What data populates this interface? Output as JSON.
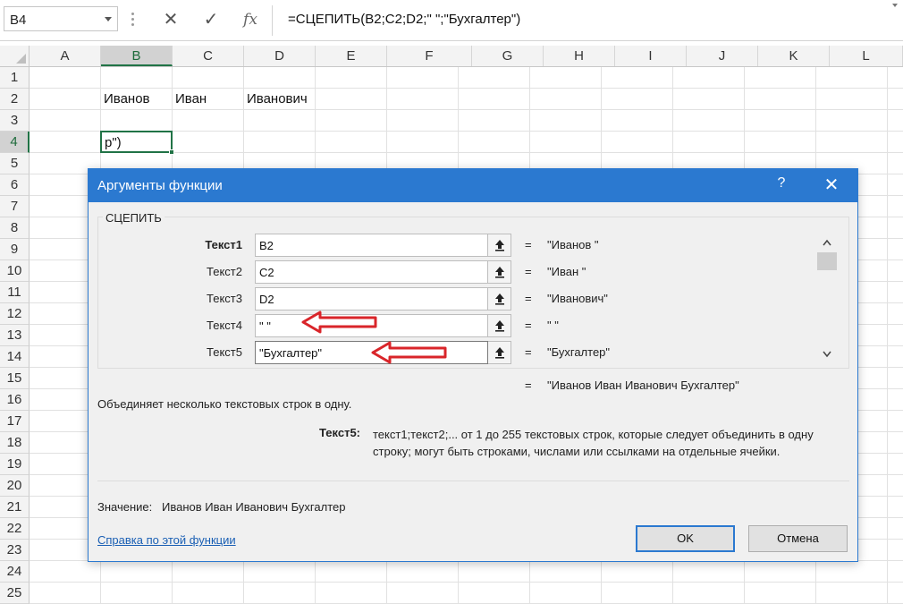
{
  "formula_bar": {
    "name_box": "B4",
    "formula": "=СЦЕПИТЬ(B2;C2;D2;\" \";\"Бухгалтер\")",
    "cancel_icon": "✕",
    "enter_icon": "✓",
    "fx_label": "fx"
  },
  "sheet": {
    "columns": [
      "A",
      "B",
      "C",
      "D",
      "E",
      "F",
      "G",
      "H",
      "I",
      "J",
      "K",
      "L"
    ],
    "rows": [
      "1",
      "2",
      "3",
      "4",
      "5",
      "6",
      "7",
      "8",
      "9",
      "10",
      "11",
      "12",
      "13",
      "14",
      "15",
      "16",
      "17",
      "18",
      "19",
      "20",
      "21",
      "22",
      "23",
      "24",
      "25"
    ],
    "active_column": "B",
    "active_row": "4",
    "cells": {
      "B2": "Иванов",
      "C2": "Иван",
      "D2": "Иванович",
      "B4": "р\")"
    }
  },
  "dialog": {
    "title": "Аргументы функции",
    "help_icon": "?",
    "close_icon": "✕",
    "function_name": "СЦЕПИТЬ",
    "arguments": [
      {
        "label": "Текст1",
        "value": "B2",
        "result": "\"Иванов \""
      },
      {
        "label": "Текст2",
        "value": "C2",
        "result": "\"Иван \""
      },
      {
        "label": "Текст3",
        "value": "D2",
        "result": "\"Иванович\""
      },
      {
        "label": "Текст4",
        "value": "\" \"",
        "result": "\" \""
      },
      {
        "label": "Текст5",
        "value": "\"Бухгалтер\"",
        "result": "\"Бухгалтер\""
      }
    ],
    "equals_sign": "=",
    "total_result": "\"Иванов Иван Иванович Бухгалтер\"",
    "description": "Объединяет несколько текстовых строк в одну.",
    "arg_help_label": "Текст5:",
    "arg_help_text": "текст1;текст2;... от 1 до 255 текстовых строк, которые следует объединить в одну строку; могут быть строками, числами или ссылками на отдельные ячейки.",
    "value_label": "Значение:",
    "value_text": "Иванов Иван Иванович Бухгалтер",
    "help_link": "Справка по этой функции",
    "ok_label": "OK",
    "cancel_label": "Отмена"
  },
  "colors": {
    "excel_green": "#217346",
    "dialog_titlebar": "#2b79d0",
    "annotation_arrow": "#d9252a"
  }
}
